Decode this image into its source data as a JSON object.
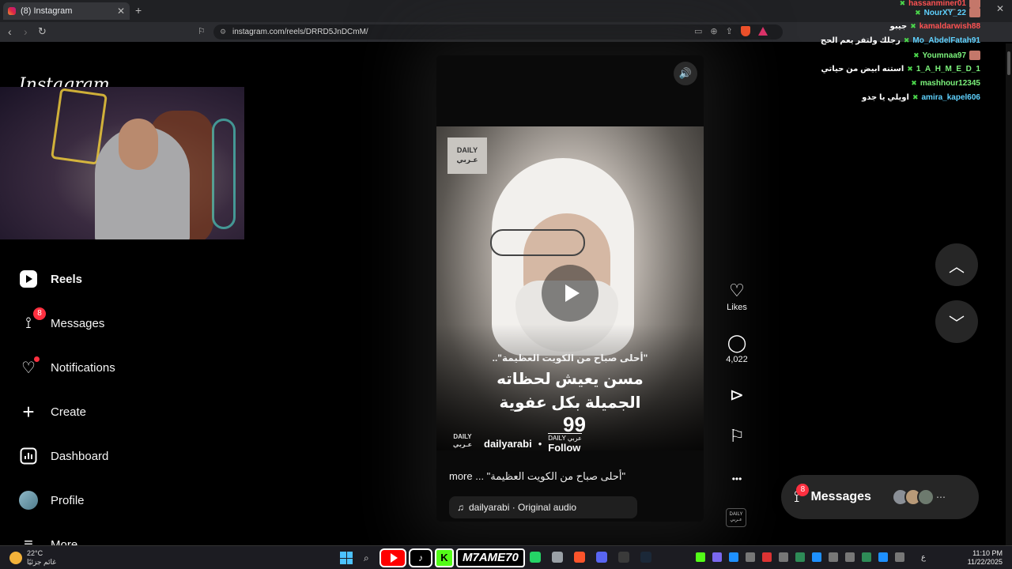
{
  "browser": {
    "tab_title": "(8) Instagram",
    "tab_close": "✕",
    "new_tab": "+",
    "url": "instagram.com/reels/DRRD5JnDCmM/",
    "window_controls": [
      "—",
      "▢",
      "✕"
    ]
  },
  "sidebar": {
    "logo": "Instagram",
    "items": [
      {
        "label": "Reels",
        "icon": "reels-icon"
      },
      {
        "label": "Messages",
        "icon": "messenger-icon",
        "badge": "8"
      },
      {
        "label": "Notifications",
        "icon": "heart-icon",
        "dot": true
      },
      {
        "label": "Create",
        "icon": "plus-icon"
      },
      {
        "label": "Dashboard",
        "icon": "chart-icon"
      },
      {
        "label": "Profile",
        "icon": "avatar-icon"
      },
      {
        "label": "More",
        "icon": "menu-icon"
      }
    ]
  },
  "reel": {
    "brand_logo_top": "DAILY",
    "brand_logo_bottom": "عـربي",
    "quote_small": "\"أحلى صباح من الكويت العظيمة\"..",
    "quote_big_line1": "مسن يعيش لحظاته",
    "quote_big_line2": "الجميلة بكل عفوية",
    "quote_mark": "99",
    "author_avatar_top": "DAILY",
    "author_avatar_bottom": "عـربي",
    "author_name": "dailyarabi",
    "separator": "•",
    "follow_top": "DAILY عربي",
    "follow_label": "Follow",
    "caption": "more ... \"أحلى صباح من الكويت العظيمة\"",
    "audio": "dailyarabi · Original audio"
  },
  "actions": {
    "like_label": "Likes",
    "comment_count": "4,022",
    "more": "•••",
    "thumb_top": "DAILY",
    "thumb_bottom": "عـربي"
  },
  "messages_pill": {
    "label": "Messages",
    "badge": "8",
    "more": "⋯"
  },
  "chat": [
    {
      "user": "hassanminer01",
      "text": "",
      "color": "r",
      "emote": true
    },
    {
      "user": "NourXY_22",
      "text": "",
      "color": "",
      "emote": true
    },
    {
      "user": "kamaldarwish88",
      "text": "جيبو",
      "color": "r",
      "emote": false
    },
    {
      "user": "Mo_AbdelFatah91",
      "text": "رجلك ولتفر يعم الحج",
      "color": "",
      "emote": false
    },
    {
      "user": "Youmnaa97",
      "text": "",
      "color": "g",
      "emote": true
    },
    {
      "user": "1_A_H_M_E_D_1",
      "text": "استنه ابيض من حياتي",
      "color": "g",
      "emote": false
    },
    {
      "user": "mashhour12345",
      "text": "",
      "color": "g",
      "emote": false
    },
    {
      "user": "amira_kapel606",
      "text": "اويلي يا جدو",
      "color": "",
      "emote": false
    }
  ],
  "taskbar": {
    "temp": "22°C",
    "weather_text": "غائم جزئيًا",
    "banner_handle": "M7AME70",
    "banner_kick": "K",
    "banner_tiktok": "♪",
    "lang": "ع",
    "time": "11:10 PM",
    "date": "11/22/2025"
  },
  "colors": {
    "badge": "#ff3040",
    "pill_bg": "#262626",
    "chat_user": "#5fd2ff",
    "chat_user_green": "#7cf37c"
  }
}
